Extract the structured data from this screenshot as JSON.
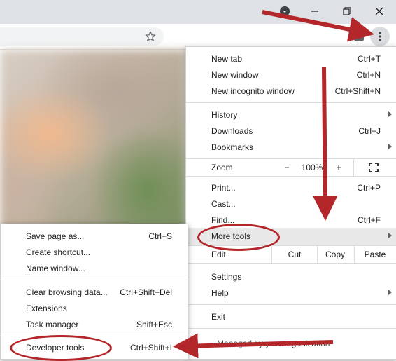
{
  "main_menu": {
    "new_tab": {
      "label": "New tab",
      "shortcut": "Ctrl+T"
    },
    "new_window": {
      "label": "New window",
      "shortcut": "Ctrl+N"
    },
    "new_incognito": {
      "label": "New incognito window",
      "shortcut": "Ctrl+Shift+N"
    },
    "history": {
      "label": "History"
    },
    "downloads": {
      "label": "Downloads",
      "shortcut": "Ctrl+J"
    },
    "bookmarks": {
      "label": "Bookmarks"
    },
    "zoom": {
      "label": "Zoom",
      "minus": "−",
      "value": "100%",
      "plus": "+"
    },
    "print": {
      "label": "Print...",
      "shortcut": "Ctrl+P"
    },
    "cast": {
      "label": "Cast..."
    },
    "find": {
      "label": "Find...",
      "shortcut": "Ctrl+F"
    },
    "more_tools": {
      "label": "More tools"
    },
    "edit": {
      "label": "Edit",
      "cut": "Cut",
      "copy": "Copy",
      "paste": "Paste"
    },
    "settings": {
      "label": "Settings"
    },
    "help": {
      "label": "Help"
    },
    "exit": {
      "label": "Exit"
    },
    "managed": {
      "label": "Managed by your organization"
    }
  },
  "more_tools_menu": {
    "save_page": {
      "label": "Save page as...",
      "shortcut": "Ctrl+S"
    },
    "create_shortcut": {
      "label": "Create shortcut..."
    },
    "name_window": {
      "label": "Name window..."
    },
    "clear_browsing": {
      "label": "Clear browsing data...",
      "shortcut": "Ctrl+Shift+Del"
    },
    "extensions": {
      "label": "Extensions"
    },
    "task_manager": {
      "label": "Task manager",
      "shortcut": "Shift+Esc"
    },
    "developer_tools": {
      "label": "Developer tools",
      "shortcut": "Ctrl+Shift+I"
    }
  },
  "icons": [
    "minimize-icon",
    "maximize-icon",
    "close-icon",
    "star-icon",
    "kebab-menu-icon",
    "fullscreen-icon",
    "chevron-right-icon"
  ],
  "colors": {
    "annotation_red": "#b3262a",
    "highlight": "#e8e8e8"
  }
}
